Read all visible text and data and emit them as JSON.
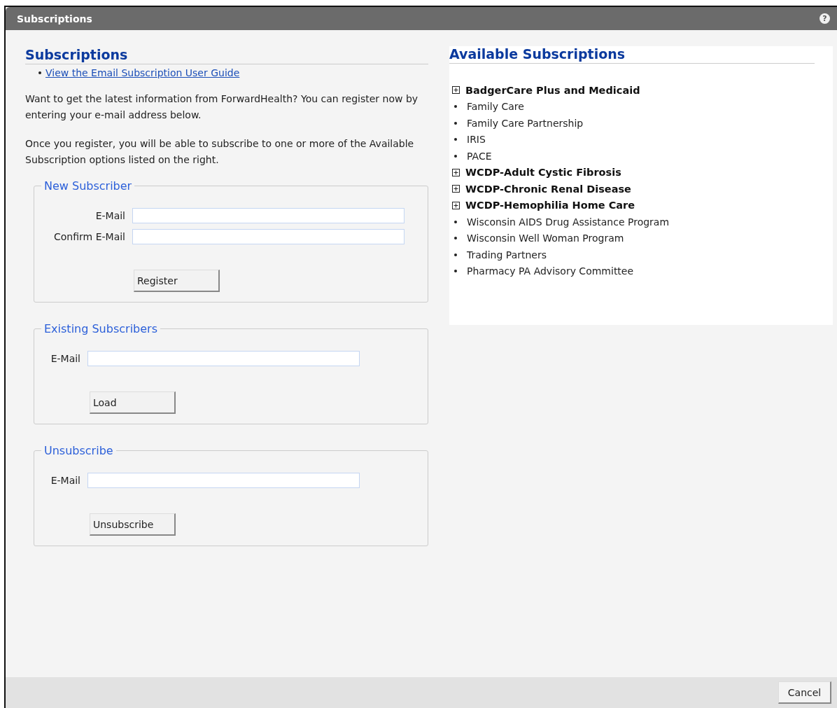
{
  "window": {
    "title": "Subscriptions",
    "help": "?"
  },
  "left": {
    "heading": "Subscriptions",
    "links": [
      "View the Email Subscription User Guide"
    ],
    "paragraphs": [
      "Want to get the latest information from ForwardHealth? You can register now by entering your e-mail address below.",
      "Once you register, you will be able to subscribe to one or more of the Available Subscription options listed on the right."
    ],
    "sections": [
      {
        "legend": "New Subscriber",
        "fields": [
          {
            "label": "E-Mail"
          },
          {
            "label": "Confirm E-Mail"
          }
        ],
        "button": "Register"
      },
      {
        "legend": "Existing Subscribers",
        "fields": [
          {
            "label": "E-Mail"
          }
        ],
        "button": "Load"
      },
      {
        "legend": "Unsubscribe",
        "fields": [
          {
            "label": "E-Mail"
          }
        ],
        "button": "Unsubscribe"
      }
    ]
  },
  "right": {
    "heading": "Available Subscriptions",
    "items": [
      {
        "kind": "group",
        "label": "BadgerCare Plus and Medicaid",
        "expanded": false
      },
      {
        "kind": "item",
        "label": "Family Care"
      },
      {
        "kind": "item",
        "label": "Family Care Partnership"
      },
      {
        "kind": "item",
        "label": "IRIS"
      },
      {
        "kind": "item",
        "label": "PACE"
      },
      {
        "kind": "group",
        "label": "WCDP-Adult Cystic Fibrosis",
        "expanded": false
      },
      {
        "kind": "group",
        "label": "WCDP-Chronic Renal Disease",
        "expanded": false
      },
      {
        "kind": "group",
        "label": "WCDP-Hemophilia Home Care",
        "expanded": false
      },
      {
        "kind": "item",
        "label": "Wisconsin AIDS Drug Assistance Program"
      },
      {
        "kind": "item",
        "label": "Wisconsin Well Woman Program"
      },
      {
        "kind": "item",
        "label": "Trading Partners"
      },
      {
        "kind": "item",
        "label": "Pharmacy PA Advisory Committee"
      }
    ]
  },
  "footer": {
    "buttons": [
      "Cancel"
    ]
  }
}
